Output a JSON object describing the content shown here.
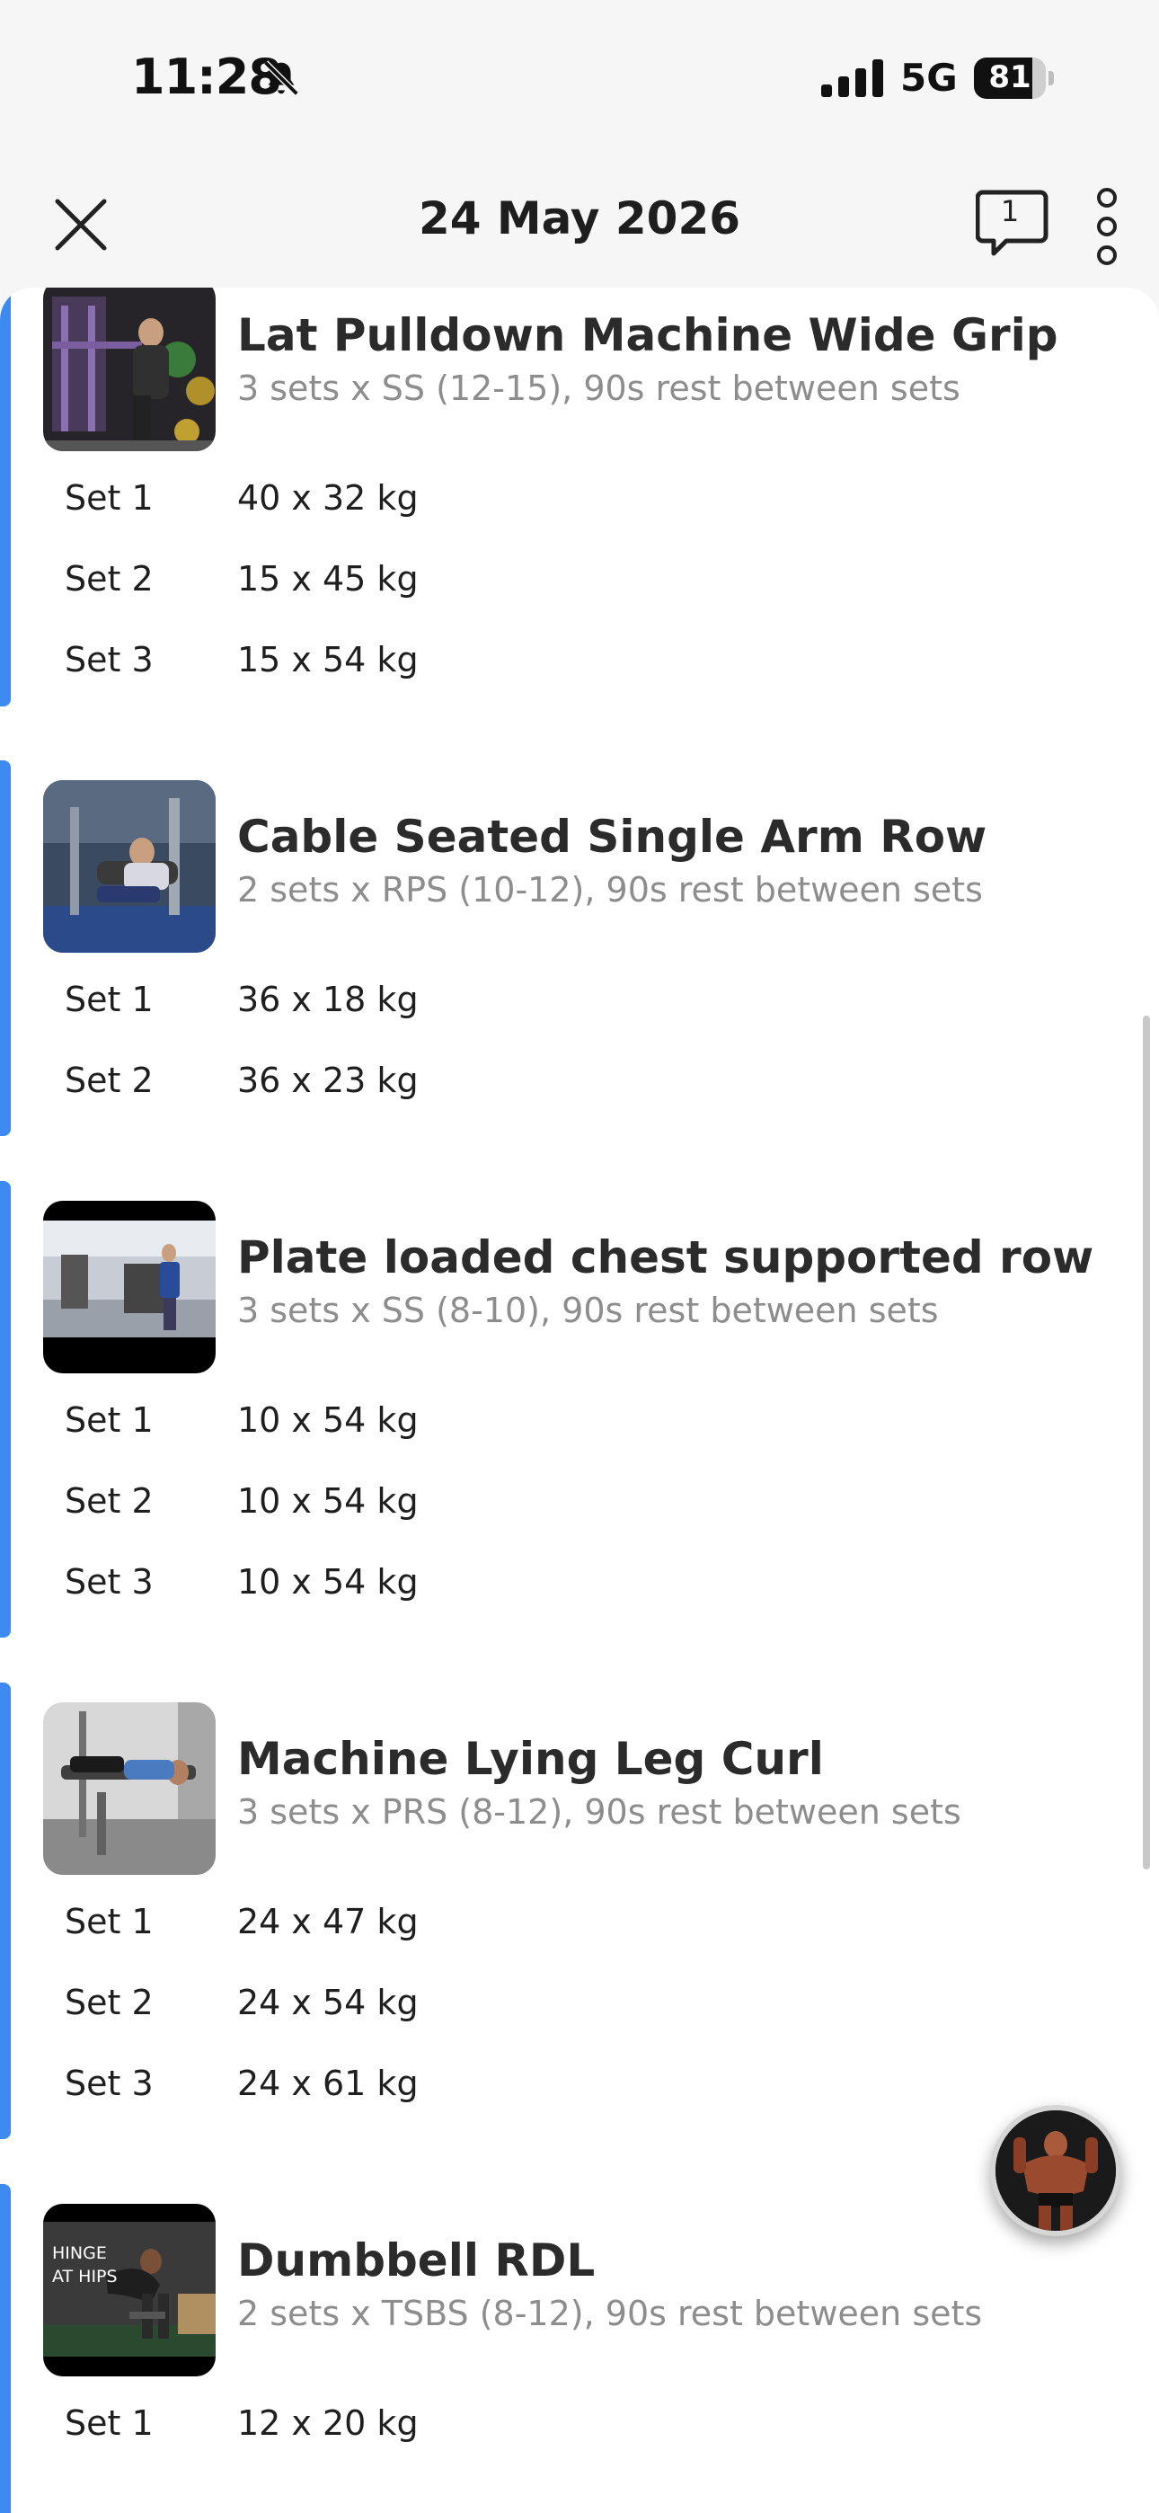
{
  "status_bar": {
    "time": "11:28",
    "network": "5G",
    "battery": "81",
    "battery_level": 0.81,
    "icons": [
      "bell-muted-icon",
      "signal-icon",
      "battery-icon"
    ]
  },
  "header": {
    "title": "24 May 2026",
    "comment_count": "1",
    "icons": [
      "close-icon",
      "comment-icon",
      "more-vertical-icon"
    ]
  },
  "exercises": [
    {
      "name": "Lat Pulldown Machine Wide Grip",
      "meta": "3 sets x SS (12-15), 90s rest between sets",
      "sets": [
        {
          "label": "Set 1",
          "value": "40 x 32 kg"
        },
        {
          "label": "Set 2",
          "value": "15 x 45 kg"
        },
        {
          "label": "Set 3",
          "value": "15 x 54 kg"
        }
      ]
    },
    {
      "name": "Cable Seated Single Arm Row",
      "meta": "2 sets x RPS (10-12), 90s rest between sets",
      "sets": [
        {
          "label": "Set 1",
          "value": "36 x 18 kg"
        },
        {
          "label": "Set 2",
          "value": "36 x 23 kg"
        }
      ]
    },
    {
      "name": "Plate loaded chest supported row",
      "meta": "3 sets x SS (8-10), 90s rest between sets",
      "sets": [
        {
          "label": "Set 1",
          "value": "10 x 54 kg"
        },
        {
          "label": "Set 2",
          "value": "10 x 54 kg"
        },
        {
          "label": "Set 3",
          "value": "10 x 54 kg"
        }
      ]
    },
    {
      "name": "Machine Lying Leg Curl",
      "meta": "3 sets x PRS (8-12), 90s rest between sets",
      "sets": [
        {
          "label": "Set 1",
          "value": "24 x 47 kg"
        },
        {
          "label": "Set 2",
          "value": "24 x 54 kg"
        },
        {
          "label": "Set 3",
          "value": "24 x 61 kg"
        }
      ]
    },
    {
      "name": "Dumbbell RDL",
      "meta": "2 sets x TSBS (8-12), 90s rest between sets",
      "thumb_caption": "HINGE AT HIPS",
      "sets": [
        {
          "label": "Set 1",
          "value": "12 x 20 kg"
        }
      ]
    }
  ],
  "colors": {
    "accent": "#3d8bf2",
    "meta_text": "#8d8d8d"
  }
}
